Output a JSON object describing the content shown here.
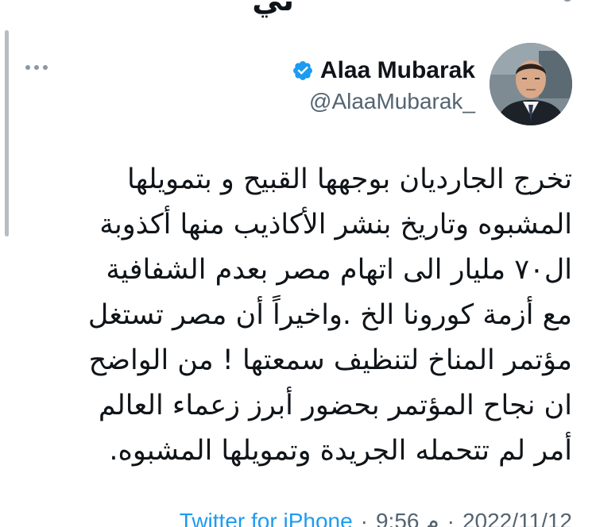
{
  "previous_tweet": {
    "cut_text": "ني"
  },
  "author": {
    "display_name": "Alaa Mubarak",
    "handle": "@AlaaMubarak_",
    "verified": true,
    "verified_color": "#1d9bf0",
    "avatar_icon": "avatar-photo"
  },
  "menu": {
    "icon": "more-horizontal-icon"
  },
  "tweet": {
    "lines": [
      "تخرج الجارديان بوجهها القبيح و بتمويلها",
      "المشبوه وتاريخ بنشر الأكاذيب منها أكذوبة",
      "ال٧٠ مليار الى اتهام مصر بعدم الشفافية",
      "مع أزمة كورونا الخ .واخيراً أن مصر تستغل",
      "مؤتمر المناخ لتنظيف سمعتها ! من الواضح",
      "ان نجاح المؤتمر بحضور أبرز زعماء العالم",
      "أمر لم تتحمله الجريدة وتمويلها المشبوه."
    ]
  },
  "meta": {
    "date": "2022/11/12",
    "separator1": "·",
    "time": "9:56 م",
    "separator2": "·",
    "source": "Twitter for iPhone"
  },
  "colors": {
    "text": "#0f1419",
    "secondary": "#536471",
    "link": "#1d9bf0",
    "scrollbar": "#b8bcc0"
  }
}
